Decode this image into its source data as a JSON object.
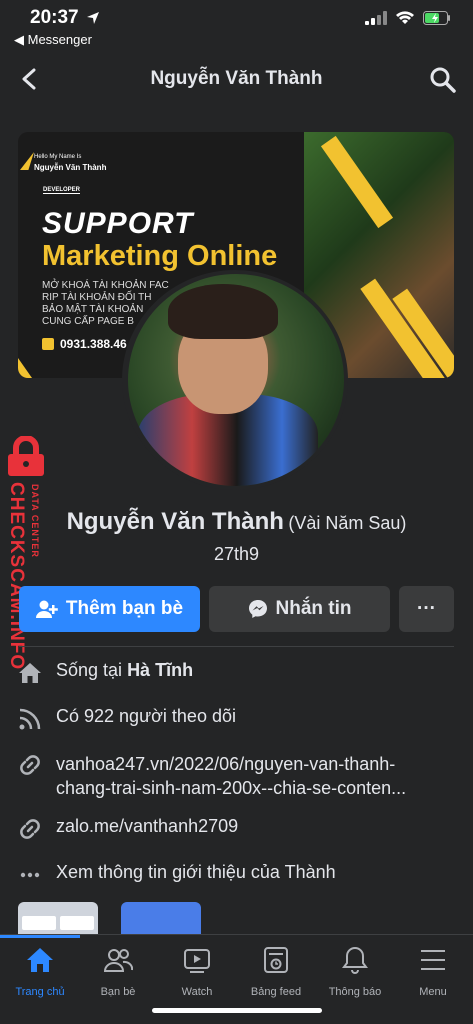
{
  "status_bar": {
    "time": "20:37",
    "back_app": "◀ Messenger"
  },
  "topnav": {
    "title": "Nguyễn Văn Thành"
  },
  "cover": {
    "hello": "Hello My Name Is",
    "hello_name": "Nguyễn Văn Thành",
    "developer": "DEVELOPER",
    "support": "SUPPORT",
    "marketing": "Marketing Online",
    "line1": "MỞ KHOÁ TÀI KHOẢN FAC",
    "line2": "RIP TÀI KHOẢN ĐỐI TH",
    "line3": "BẢO MẬT TÀI KHOẢN",
    "line4": "CUNG CẤP PAGE B",
    "phone": "0931.388.46"
  },
  "watermark": {
    "brand": "CHECKSCAM.INFO",
    "sub": "DATA CENTER"
  },
  "profile": {
    "name": "Nguyễn Văn Thành",
    "alt_name": "(Vài Năm Sau)",
    "bio": "27th9"
  },
  "actions": {
    "add_friend": "Thêm bạn bè",
    "message": "Nhắn tin",
    "more": "···"
  },
  "info": {
    "lives_prefix": "Sống tại ",
    "lives_place": "Hà Tĩnh",
    "followers": "Có 922 người theo dõi",
    "link1_line1": "vanhoa247.vn/2022/06/nguyen-van-thanh-",
    "link1_line2": "chang-trai-sinh-nam-200x--chia-se-conten...",
    "link2": "zalo.me/vanthanh2709",
    "see_about": "Xem thông tin giới thiệu của Thành"
  },
  "tabs": [
    {
      "label": "Trang chủ",
      "icon": "home-icon"
    },
    {
      "label": "Bạn bè",
      "icon": "friends-icon"
    },
    {
      "label": "Watch",
      "icon": "watch-icon"
    },
    {
      "label": "Bảng feed",
      "icon": "feed-icon"
    },
    {
      "label": "Thông báo",
      "icon": "bell-icon"
    },
    {
      "label": "Menu",
      "icon": "menu-icon"
    }
  ],
  "colors": {
    "accent": "#2d88ff",
    "background": "#242526",
    "watermark": "#e8323a",
    "cover_yellow": "#f2c230"
  }
}
